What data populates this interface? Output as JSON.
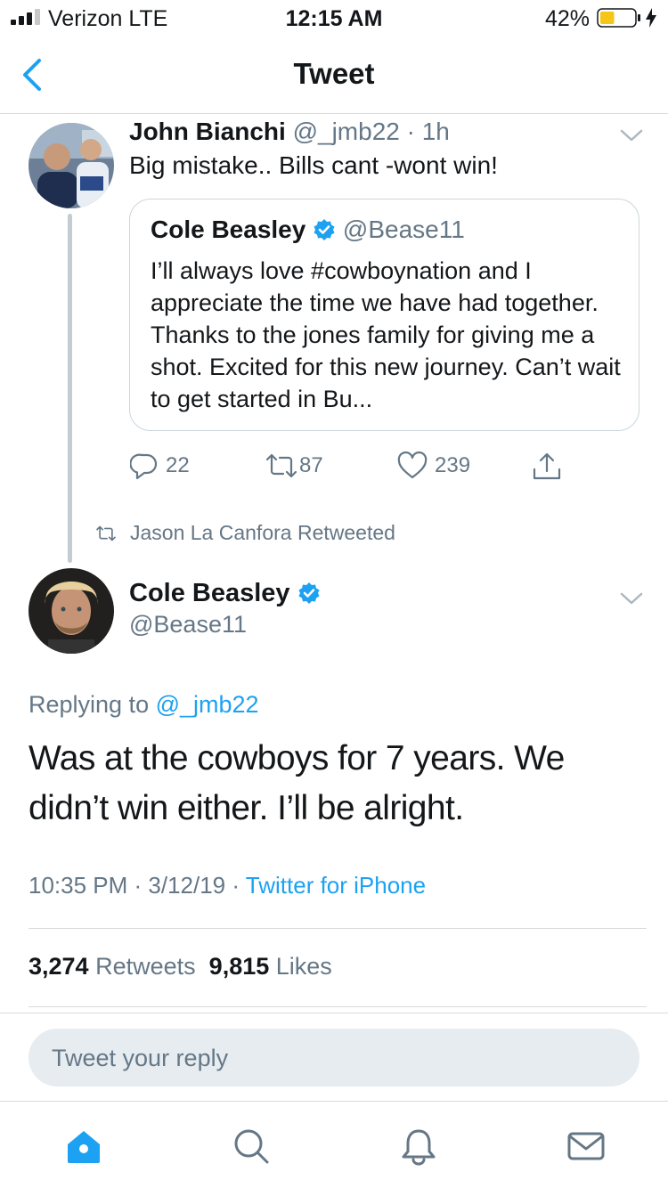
{
  "status_bar": {
    "carrier": "Verizon  LTE",
    "time": "12:15 AM",
    "battery": "42%",
    "battery_level": 0.42
  },
  "nav": {
    "title": "Tweet",
    "back_icon": "chevron-left-icon"
  },
  "reply_tweet": {
    "name": "John Bianchi",
    "handle": "@_jmb22",
    "time": "· 1h",
    "text": "Big mistake.. Bills cant -wont win!",
    "quote": {
      "name": "Cole Beasley",
      "handle": "@Bease11",
      "verified": true,
      "text": "I’ll always love #cowboynation and I appreciate the time we have had together. Thanks to the jones family for giving me a shot. Excited for this new journey. Can’t wait to get started in Bu..."
    },
    "actions": {
      "replies": "22",
      "retweets": "87",
      "likes": "239"
    }
  },
  "retweet_label": "Jason La Canfora Retweeted",
  "main_tweet": {
    "name": "Cole Beasley",
    "handle": "@Bease11",
    "verified": true,
    "replying_prefix": "Replying to ",
    "replying_to": "@_jmb22",
    "text": "Was at the cowboys for 7 years. We didn’t win either. I’ll be alright.",
    "time_date": "10:35 PM · 3/12/19 · ",
    "source": "Twitter for iPhone",
    "retweets_count": "3,274",
    "retweets_label": "Retweets",
    "likes_count": "9,815",
    "likes_label": "Likes"
  },
  "reply_input": {
    "placeholder": "Tweet your reply"
  },
  "tab_bar": [
    "home-icon",
    "search-icon",
    "notifications-icon",
    "messages-icon"
  ],
  "colors": {
    "accent": "#1da1f2",
    "text": "#14171a",
    "secondary": "#657786",
    "battery": "#f5c518"
  }
}
